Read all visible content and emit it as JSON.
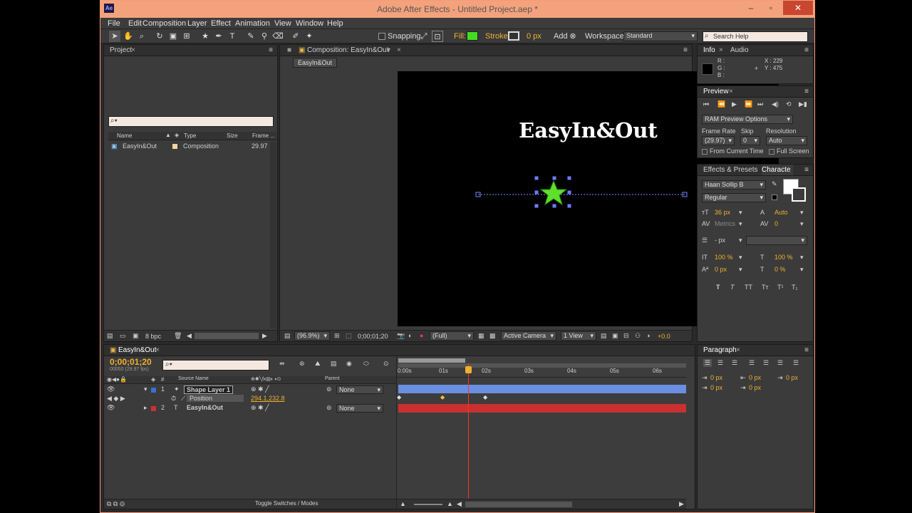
{
  "app": {
    "title": "Adobe After Effects - Untitled Project.aep *"
  },
  "menu": [
    "File",
    "Edit",
    "Composition",
    "Layer",
    "Effect",
    "Animation",
    "View",
    "Window",
    "Help"
  ],
  "toolbar": {
    "snapping": "Snapping",
    "fill": "Fill:",
    "stroke": "Stroke:",
    "stroke_px": "0 px",
    "add": "Add",
    "workspace_label": "Workspace:",
    "workspace": "Standard",
    "search_help": "Search Help",
    "fill_color": "#44dd22"
  },
  "project": {
    "tab": "Project",
    "columns": [
      "Name",
      "Type",
      "Size",
      "Frame ..."
    ],
    "items": [
      {
        "name": "EasyIn&Out",
        "type": "Composition",
        "fps": "29.97"
      }
    ],
    "bpc": "8 bpc"
  },
  "comp": {
    "tab": "Composition: EasyIn&Out",
    "crumb": "EasyIn&Out",
    "title": "EasyIn&Out",
    "zoom": "(96.9%)",
    "time": "0;00;01;20",
    "quality": "(Full)",
    "camera": "Active Camera",
    "view": "1 View",
    "exposure": "+0.0",
    "star_color": "#5fe02a"
  },
  "info": {
    "tab": "Info",
    "tab2": "Audio",
    "r": "R :",
    "g": "G :",
    "b": "B :",
    "x": "X : 229",
    "y": "Y : 475"
  },
  "preview": {
    "tab": "Preview",
    "ram": "RAM Preview Options",
    "frame_rate_label": "Frame Rate",
    "skip_label": "Skip",
    "resolution_label": "Resolution",
    "frame_rate": "(29.97)",
    "skip": "0",
    "resolution": "Auto",
    "from_current": "From Current Time",
    "full_screen": "Full Screen"
  },
  "character": {
    "tab1": "Effects & Presets",
    "tab2": "Characte",
    "font": "Haan Sollip B",
    "style": "Regular",
    "size": "36 px",
    "leading": "Auto",
    "kerning": "Metrics",
    "tracking": "0",
    "stroke": "- px",
    "vscale": "100 %",
    "hscale": "100 %",
    "baseline": "0 px",
    "tsume": "0 %",
    "styles": [
      "T",
      "T",
      "TT",
      "Tт",
      "T¹",
      "T₁"
    ]
  },
  "paragraph": {
    "tab": "Paragraph",
    "i1": "0 px",
    "i2": "0 px",
    "i3": "0 px",
    "s1": "0 px",
    "s2": "0 px"
  },
  "timeline": {
    "tab": "EasyIn&Out",
    "time": "0;00;01;20",
    "frames": "00050 (29.97 fps)",
    "col_source": "Source Name",
    "col_parent": "Parent",
    "layers": [
      {
        "num": "1",
        "name": "Shape Layer 1",
        "parent": "None",
        "color": "#3a6fd0"
      },
      {
        "num": "2",
        "name": "EasyIn&Out",
        "parent": "None",
        "color": "#d03030"
      }
    ],
    "prop": "Position",
    "prop_value": "294.1,232.8",
    "ruler": [
      "0:00s",
      "01s",
      "02s",
      "03s",
      "04s",
      "05s",
      "06s"
    ],
    "toggle": "Toggle Switches / Modes"
  }
}
